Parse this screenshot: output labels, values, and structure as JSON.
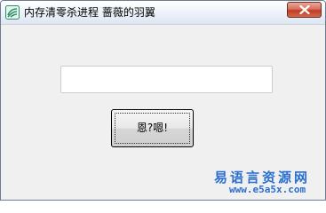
{
  "window": {
    "title": "内存清零杀进程 蔷薇的羽翼"
  },
  "titlebar": {
    "app_icon": "app-icon",
    "close_icon": "close-icon"
  },
  "main": {
    "input_value": "",
    "button_label": "恩?嗯!"
  },
  "watermark": {
    "name": "易语言资源网",
    "url": "www.e5a5x.com"
  },
  "colors": {
    "watermark": "#2b6fd0",
    "close_button": "#c13c24",
    "window_bg": "#f0f0f0"
  }
}
